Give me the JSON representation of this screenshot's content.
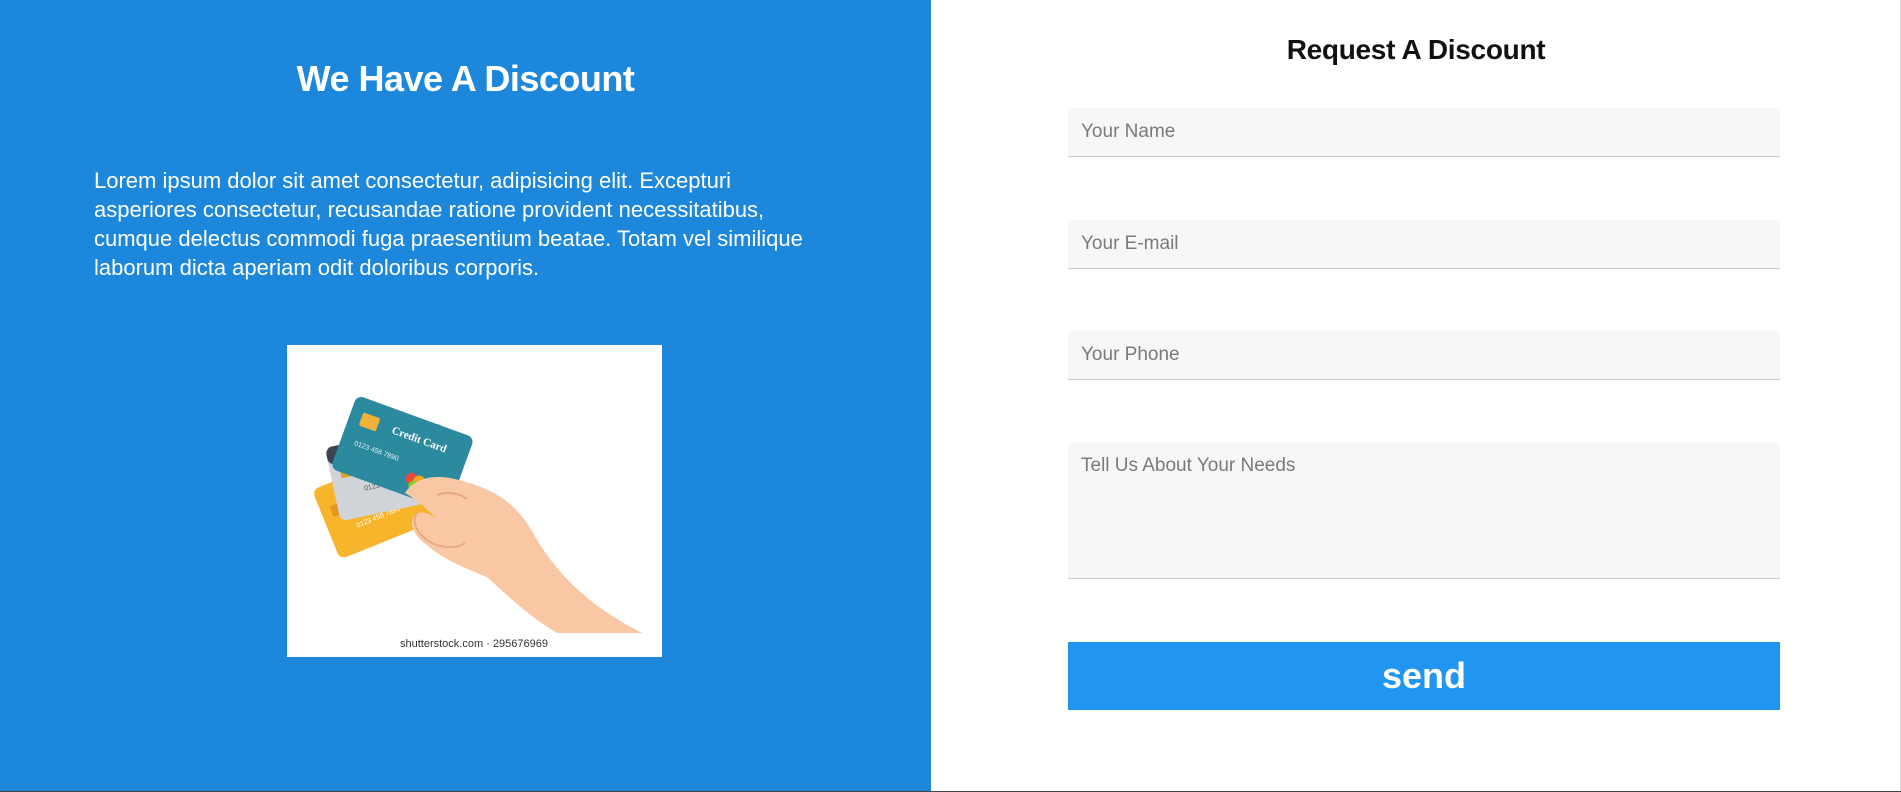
{
  "promo": {
    "title": "We Have A Discount",
    "description": "Lorem ipsum dolor sit amet consectetur, adipisicing elit. Excepturi asperiores consectetur, recusandae ratione provident necessitatibus, cumque delectus commodi fuga praesentium beatae. Totam vel similique laborum dicta aperiam odit doloribus corporis.",
    "image": {
      "icon": "hand-holding-credit-cards",
      "card_text": "Credit Card",
      "card_number": "0123 456 7890",
      "watermark": "shutterstock.com · 295676969"
    },
    "background_color": "#1d87dc"
  },
  "form": {
    "title": "Request A Discount",
    "name_placeholder": "Your Name",
    "email_placeholder": "Your E-mail",
    "phone_placeholder": "Your Phone",
    "needs_placeholder": "Tell Us About Your Needs",
    "send_label": "send",
    "button_color": "#2196f0"
  }
}
